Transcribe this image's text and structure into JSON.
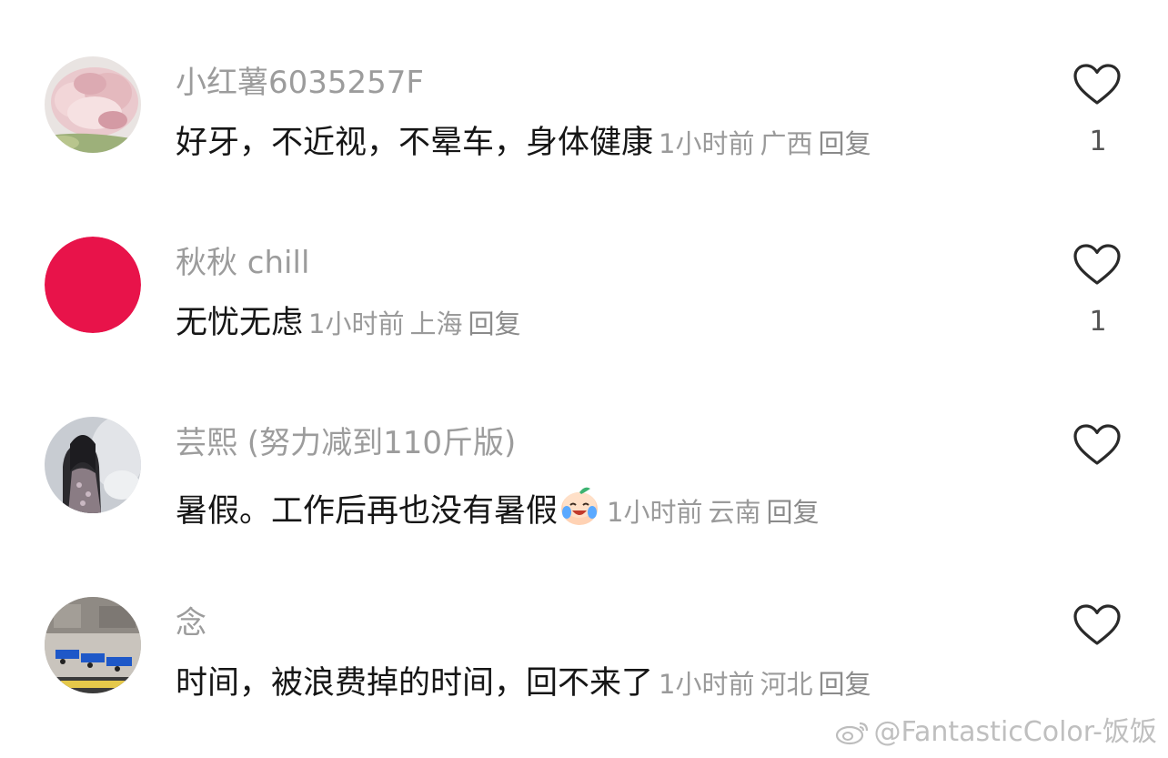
{
  "comments": [
    {
      "username": "小红薯6035257F",
      "text": "好牙，不近视，不晕车，身体健康",
      "time": "1小时前",
      "location": "广西",
      "reply_label": "回复",
      "likes": "1",
      "avatar": "pink-flower-photo"
    },
    {
      "username": "秋秋 chill",
      "text": "无忧无虑",
      "time": "1小时前",
      "location": "上海",
      "reply_label": "回复",
      "likes": "1",
      "avatar": "red-circle",
      "avatar_color": "#e8134a"
    },
    {
      "username": "芸熙 (努力减到110斤版)",
      "text": "暑假。工作后再也没有暑假",
      "time": "1小时前",
      "location": "云南",
      "reply_label": "回复",
      "likes": "",
      "avatar": "person-portrait-photo",
      "emoji": "crying-laughing-peach-emoji"
    },
    {
      "username": "念",
      "text": "时间，被浪费掉的时间，回不来了",
      "time": "1小时前",
      "location": "河北",
      "reply_label": "回复",
      "likes": "",
      "avatar": "factory-photo"
    }
  ],
  "watermark": {
    "text": "@FantasticColor-饭饭",
    "icon": "weibo-icon"
  }
}
